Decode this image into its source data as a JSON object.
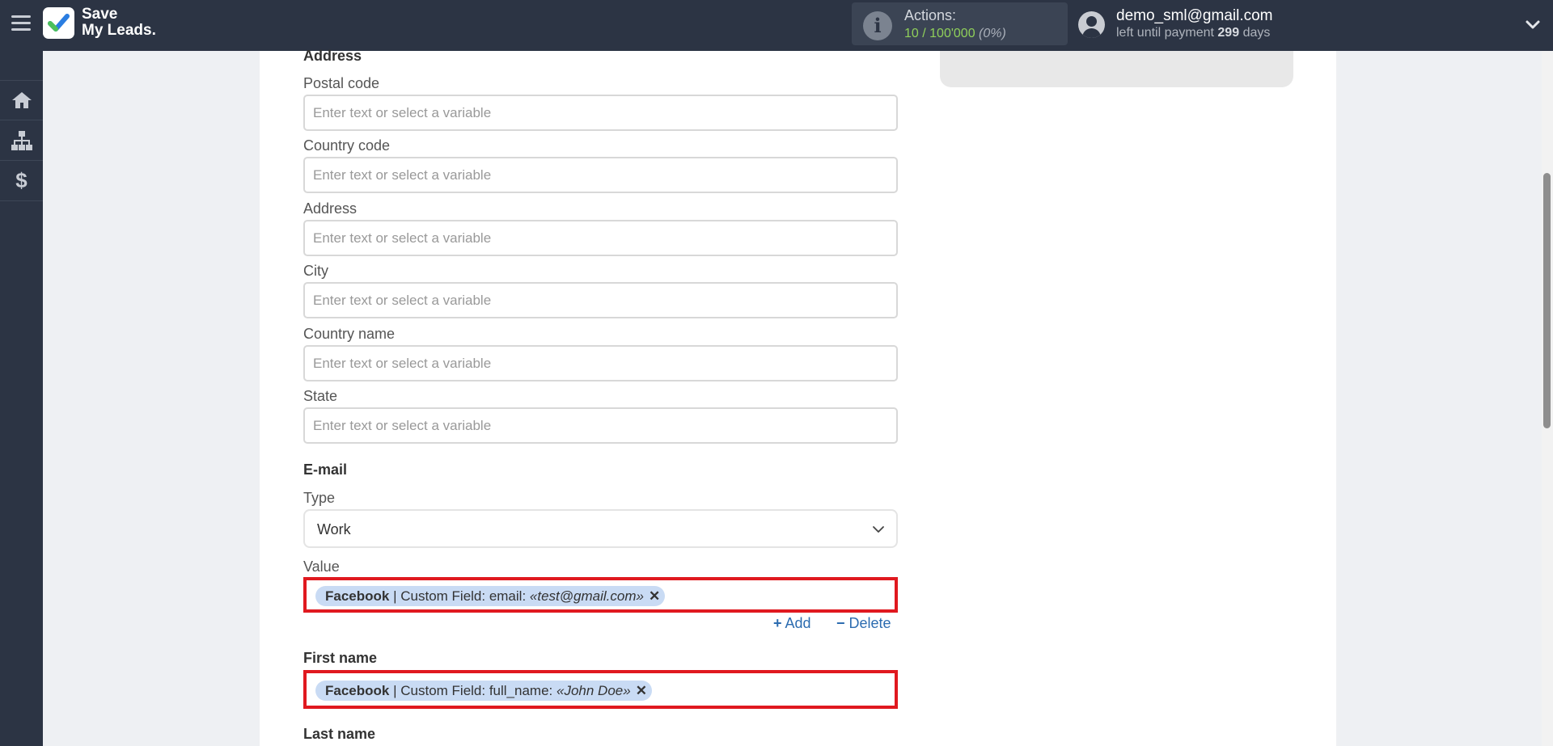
{
  "header": {
    "logo_line1": "Save",
    "logo_line2": "My Leads.",
    "actions_label": "Actions:",
    "actions_used": "10",
    "actions_total": "100'000",
    "actions_pct": "(0%)",
    "user_email": "demo_sml@gmail.com",
    "payment_prefix": "left until payment",
    "payment_days": "299",
    "payment_suffix": "days"
  },
  "form": {
    "address_section": "Address",
    "placeholder": "Enter text or select a variable",
    "fields": {
      "postal_code": "Postal code",
      "country_code": "Country code",
      "address": "Address",
      "city": "City",
      "country_name": "Country name",
      "state": "State"
    },
    "email_section": "E-mail",
    "type_label": "Type",
    "type_value": "Work",
    "value_label": "Value",
    "email_tag": {
      "source": "Facebook",
      "field": "| Custom Field: email:",
      "sample": "«test@gmail.com»"
    },
    "add_label": "Add",
    "delete_label": "Delete",
    "first_name_section": "First name",
    "first_name_tag": {
      "source": "Facebook",
      "field": "| Custom Field: full_name:",
      "sample": "«John Doe»"
    },
    "last_name_section": "Last name"
  },
  "icons": [
    "menu-icon",
    "logo-check-icon",
    "info-icon",
    "user-icon",
    "chevron-down-icon",
    "home-icon",
    "sitemap-icon",
    "dollar-icon",
    "close-icon",
    "plus-icon",
    "minus-icon"
  ]
}
